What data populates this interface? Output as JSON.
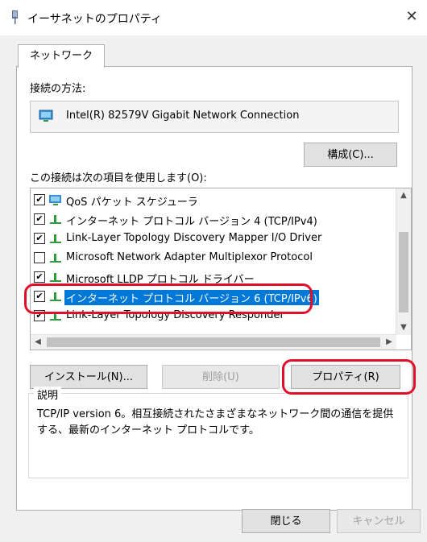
{
  "window": {
    "title": "イーサネットのプロパティ",
    "close_glyph": "✕"
  },
  "tab": {
    "label": "ネットワーク"
  },
  "connection": {
    "label": "接続の方法:",
    "adapter": "Intel(R) 82579V Gigabit Network Connection",
    "configure_button": "構成(C)..."
  },
  "items": {
    "label": "この接続は次の項目を使用します(O):",
    "list": [
      {
        "checked": true,
        "icon": "qos-scheduler-icon",
        "label": "QoS パケット スケジューラ",
        "selected": false
      },
      {
        "checked": true,
        "icon": "protocol-icon",
        "label": "インターネット プロトコル バージョン 4 (TCP/IPv4)",
        "selected": false
      },
      {
        "checked": true,
        "icon": "protocol-icon",
        "label": "Link-Layer Topology Discovery Mapper I/O Driver",
        "selected": false
      },
      {
        "checked": false,
        "icon": "protocol-icon",
        "label": "Microsoft Network Adapter Multiplexor Protocol",
        "selected": false
      },
      {
        "checked": true,
        "icon": "protocol-icon",
        "label": "Microsoft LLDP プロトコル ドライバー",
        "selected": false
      },
      {
        "checked": true,
        "icon": "protocol-icon",
        "label": "インターネット プロトコル バージョン 6 (TCP/IPv6)",
        "selected": true
      },
      {
        "checked": true,
        "icon": "protocol-icon",
        "label": "Link-Layer Topology Discovery Responder",
        "selected": false
      }
    ],
    "check_glyph": "✔"
  },
  "buttons": {
    "install": "インストール(N)...",
    "uninstall": "削除(U)",
    "properties": "プロパティ(R)",
    "ok": "閉じる",
    "cancel": "キャンセル"
  },
  "description": {
    "title": "説明",
    "text": "TCP/IP version 6。相互接続されたさまざまなネットワーク間の通信を提供する、最新のインターネット プロトコルです。"
  },
  "colors": {
    "selection": "#0078d7",
    "annotation": "#e0102a"
  }
}
